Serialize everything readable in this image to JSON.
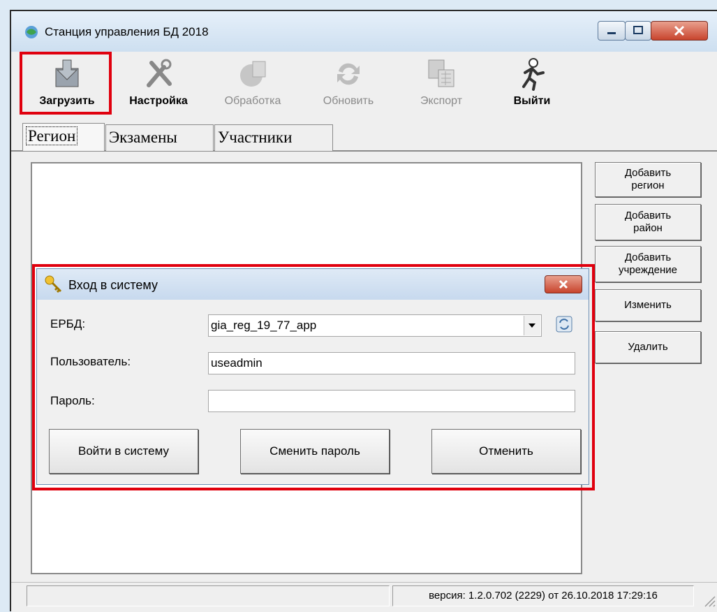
{
  "window": {
    "title": "Станция управления БД 2018"
  },
  "toolbar": {
    "load": "Загрузить",
    "settings": "Настройка",
    "process": "Обработка",
    "refresh": "Обновить",
    "export": "Экспорт",
    "exit": "Выйти"
  },
  "tabs": [
    "Регион",
    "Экзамены",
    "Участники"
  ],
  "side_buttons": {
    "add_region": [
      "Добавить",
      "регион"
    ],
    "add_district": [
      "Добавить",
      "район"
    ],
    "add_institution": [
      "Добавить",
      "учреждение"
    ],
    "edit": "Изменить",
    "delete": "Удалить"
  },
  "status": {
    "version": "версия: 1.2.0.702 (2229) от 26.10.2018 17:29:16"
  },
  "login_dialog": {
    "title": "Вход в систему",
    "erbd_label": "ЕРБД:",
    "erbd_value": "gia_reg_19_77_app",
    "user_label": "Пользователь:",
    "user_value": "useadmin",
    "password_label": "Пароль:",
    "password_value": "",
    "login_button": "Войти в систему",
    "change_password_button": "Сменить пароль",
    "cancel_button": "Отменить"
  },
  "colors": {
    "highlight": "#e0000e",
    "titlebar": "#cddff0"
  }
}
